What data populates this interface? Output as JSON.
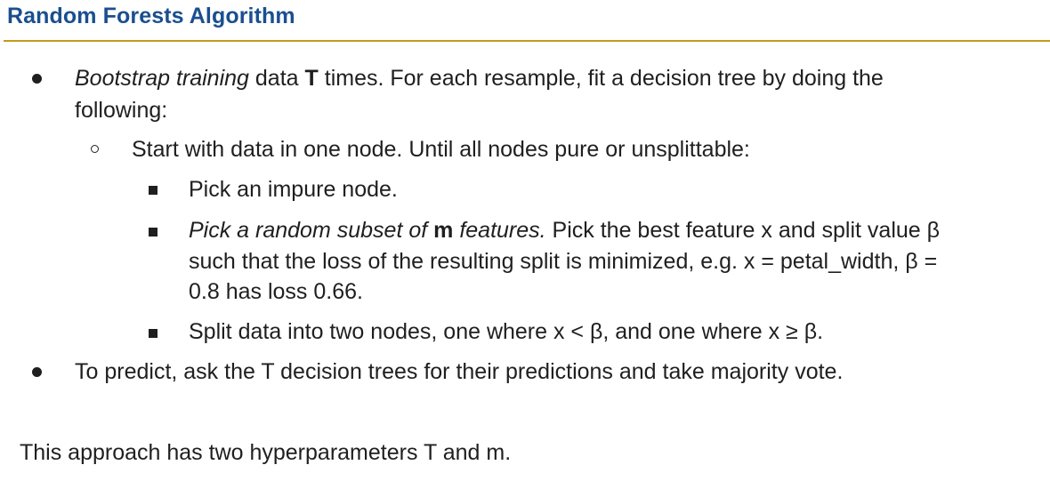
{
  "title": "Random Forests Algorithm",
  "bullets": {
    "b1": {
      "emph": "Bootstrap training",
      "t1": " data ",
      "var": "T",
      "t2": " times. For each resample, fit a decision tree by doing the",
      "line2": "following:"
    },
    "sub1": "Start with data in one node. Until all nodes pure or unsplittable:",
    "s1": "Pick an impure node.",
    "s2": {
      "emph1": "Pick a random subset of ",
      "var": "m",
      "emph2": " features.",
      "t1": " Pick the best feature x and split value β",
      "line2": "such that the loss of the resulting split is minimized, e.g. x = petal_width, β =",
      "line3": "0.8 has loss 0.66."
    },
    "s3": "Split data into two nodes, one where x < β, and one where x ≥ β.",
    "b2": "To predict, ask the T decision trees for their predictions and take majority vote."
  },
  "footer": "This approach has two hyperparameters T and m."
}
